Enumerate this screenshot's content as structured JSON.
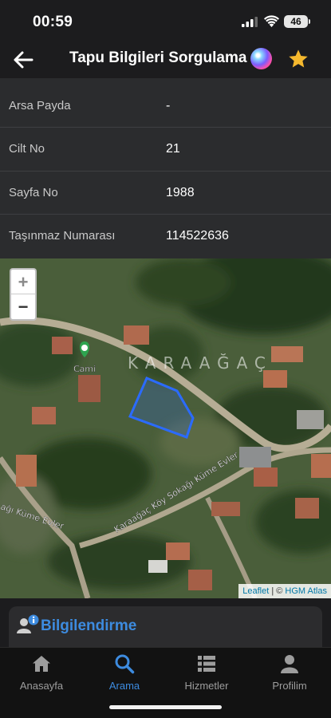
{
  "status_bar": {
    "time": "00:59",
    "battery_level": "46"
  },
  "nav": {
    "title": "Tapu Bilgileri Sorgulama",
    "back_icon": "arrow-left-icon",
    "siri_icon": "siri-icon",
    "favorite_icon": "star-icon",
    "star_color": "#f5b82e"
  },
  "details": {
    "rows": [
      {
        "label": "Arsa Payda",
        "value": "-"
      },
      {
        "label": "Cilt No",
        "value": "21"
      },
      {
        "label": "Sayfa No",
        "value": "1988"
      },
      {
        "label": "Taşınmaz Numarası",
        "value": "114522636"
      }
    ]
  },
  "map": {
    "zoom_in": "+",
    "zoom_out": "−",
    "village_label": "KARAAĞAÇ",
    "poi_label": "Cami",
    "street_label": "Karaağaç Köy Sokağı Küme Evler",
    "street_label_2": "ağı Küme Evler",
    "parcel_color": "#2b6bff",
    "attribution": {
      "leaflet": "Leaflet",
      "sep": " | © ",
      "provider": "HGM Atlas"
    }
  },
  "info": {
    "title": "Bilgilendirme",
    "icon": "user-info-icon"
  },
  "tabs": [
    {
      "label": "Anasayfa",
      "icon": "home-icon",
      "active": false
    },
    {
      "label": "Arama",
      "icon": "search-icon",
      "active": true
    },
    {
      "label": "Hizmetler",
      "icon": "list-icon",
      "active": false
    },
    {
      "label": "Profilim",
      "icon": "person-icon",
      "active": false
    }
  ],
  "accent_color": "#3d8bdf"
}
